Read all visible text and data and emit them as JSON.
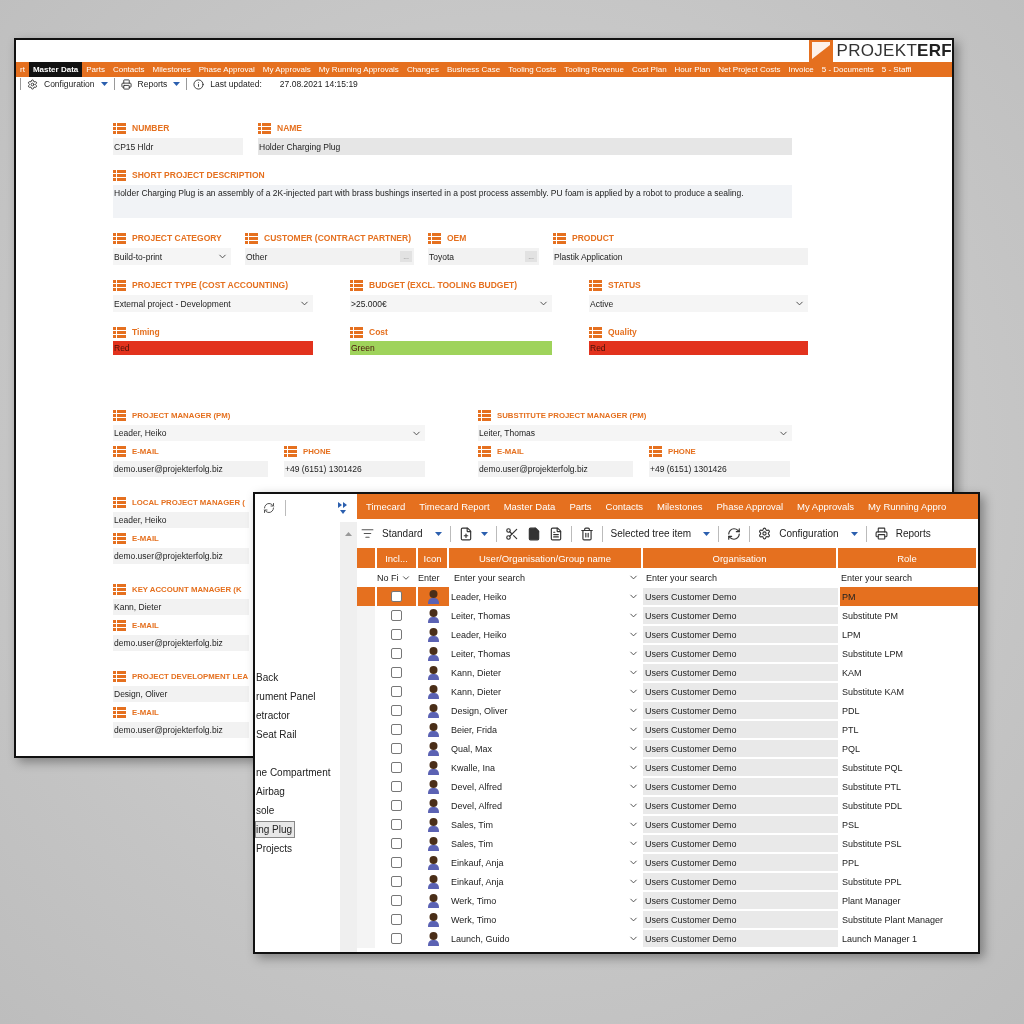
{
  "back_window": {
    "logo": "PROJEKT**ERF**",
    "tabs": [
      {
        "label": "rt",
        "selected": false
      },
      {
        "label": "Master Data",
        "selected": true
      },
      {
        "label": "Parts",
        "selected": false
      },
      {
        "label": "Contacts",
        "selected": false
      },
      {
        "label": "Milestones",
        "selected": false
      },
      {
        "label": "Phase Approval",
        "selected": false
      },
      {
        "label": "My Approvals",
        "selected": false
      },
      {
        "label": "My Running Approvals",
        "selected": false
      },
      {
        "label": "Changes",
        "selected": false
      },
      {
        "label": "Business Case",
        "selected": false
      },
      {
        "label": "Tooling Costs",
        "selected": false
      },
      {
        "label": "Tooling Revenue",
        "selected": false
      },
      {
        "label": "Cost Plan",
        "selected": false
      },
      {
        "label": "Hour Plan",
        "selected": false
      },
      {
        "label": "Net Project Costs",
        "selected": false
      },
      {
        "label": "Invoice",
        "selected": false
      },
      {
        "label": "5 - Documents",
        "selected": false
      },
      {
        "label": "5 - Staffi",
        "selected": false
      }
    ],
    "toolbar": {
      "configuration": "Configuration",
      "reports": "Reports",
      "last_updated_label": "Last updated:",
      "last_updated": "27.08.2021 14:15:19"
    },
    "form_rows": [
      [
        {
          "label": "NUMBER",
          "value": "CP15 Hldr",
          "kind": "text"
        },
        {
          "label": "NAME",
          "value": "Holder Charging Plug",
          "kind": "readonly"
        }
      ],
      [
        {
          "label": "SHORT PROJECT DESCRIPTION",
          "value": "Holder Charging Plug is an assembly of a 2K-injected part with brass bushings inserted in a post process assembly. PU foam is applied by a robot to produce a sealing.",
          "kind": "textarea"
        }
      ],
      [
        {
          "label": "PROJECT CATEGORY",
          "value": "Build-to-print",
          "kind": "select"
        },
        {
          "label": "CUSTOMER (CONTRACT PARTNER)",
          "value": "Other",
          "kind": "lookup",
          "button": "..."
        },
        {
          "label": "OEM",
          "value": "Toyota",
          "kind": "lookup",
          "button": "..."
        },
        {
          "label": "PRODUCT",
          "value": "Plastik Application",
          "kind": "text"
        }
      ],
      [
        {
          "label": "PROJECT TYPE (COST ACCOUNTING)",
          "value": "External project - Development",
          "kind": "select"
        },
        {
          "label": "BUDGET (EXCL. TOOLING BUDGET)",
          "value": ">25.000€",
          "kind": "select"
        },
        {
          "label": "STATUS",
          "value": "Active",
          "kind": "select"
        }
      ],
      [
        {
          "label": "Timing",
          "value": "Red",
          "kind": "status",
          "color": "#e2321d"
        },
        {
          "label": "Cost",
          "value": "Green",
          "kind": "status",
          "color": "#9fd35b"
        },
        {
          "label": "Quality",
          "value": "Red",
          "kind": "status",
          "color": "#e2321d"
        }
      ]
    ],
    "manager_columns": [
      [
        {
          "label": "PROJECT MANAGER (PM)",
          "value": "Leader, Heiko",
          "kind": "select",
          "contacts": [
            {
              "label": "E-MAIL",
              "value": "demo.user@projekterfolg.biz"
            },
            {
              "label": "PHONE",
              "value": "+49 (6151) 1301426"
            }
          ]
        },
        {
          "label": "LOCAL PROJECT MANAGER (",
          "value": "Leader, Heiko",
          "kind": "text",
          "contacts": [
            {
              "label": "E-MAIL",
              "value": "demo.user@projekterfolg.biz"
            }
          ]
        },
        {
          "label": "KEY ACCOUNT MANAGER (K",
          "value": "Kann, Dieter",
          "kind": "text",
          "contacts": [
            {
              "label": "E-MAIL",
              "value": "demo.user@projekterfolg.biz"
            }
          ]
        },
        {
          "label": "PROJECT DEVELOPMENT LEA",
          "value": "Design, Oliver",
          "kind": "text",
          "contacts": [
            {
              "label": "E-MAIL",
              "value": "demo.user@projekterfolg.biz"
            }
          ]
        }
      ],
      [
        {
          "label": "SUBSTITUTE PROJECT MANAGER (PM)",
          "value": "Leiter, Thomas",
          "kind": "select",
          "contacts": [
            {
              "label": "E-MAIL",
              "value": "demo.user@projekterfolg.biz"
            },
            {
              "label": "PHONE",
              "value": "+49 (6151) 1301426"
            }
          ]
        }
      ]
    ]
  },
  "front_window": {
    "tree_items": [
      {
        "label": "Back",
        "selected": false
      },
      {
        "label": "rument Panel",
        "selected": false
      },
      {
        "label": "etractor",
        "selected": false
      },
      {
        "label": "Seat Rail",
        "selected": false
      },
      {
        "label": "ne Compartment",
        "selected": false
      },
      {
        "label": "Airbag",
        "selected": false
      },
      {
        "label": "sole",
        "selected": false
      },
      {
        "label": "ing Plug",
        "selected": true
      },
      {
        "label": "Projects",
        "selected": false
      }
    ],
    "tabs": [
      {
        "label": "Timecard",
        "selected": false
      },
      {
        "label": "Timecard Report",
        "selected": false
      },
      {
        "label": "Master Data",
        "selected": false
      },
      {
        "label": "Parts",
        "selected": false
      },
      {
        "label": "Contacts",
        "selected": false
      },
      {
        "label": "Milestones",
        "selected": false
      },
      {
        "label": "Phase Approval",
        "selected": false
      },
      {
        "label": "My Approvals",
        "selected": false
      },
      {
        "label": "My Running Appro",
        "selected": false
      }
    ],
    "toolbar": {
      "view": "Standard",
      "scope": "Selected tree item",
      "configuration": "Configuration",
      "reports": "Reports"
    },
    "columns": [
      "Incl...",
      "Icon",
      "User/Organisation/Group name",
      "Organisation",
      "Role"
    ],
    "filters": {
      "include": "No Fi",
      "icon": "Enter",
      "name_placeholder": "Enter your search",
      "organisation_placeholder": "Enter your search",
      "role_placeholder": "Enter your search"
    },
    "rows": [
      {
        "name": "Leader, Heiko",
        "organisation": "Users Customer Demo",
        "role": "PM",
        "selected": true,
        "checked": false
      },
      {
        "name": "Leiter, Thomas",
        "organisation": "Users Customer Demo",
        "role": "Substitute PM",
        "selected": false,
        "checked": false
      },
      {
        "name": "Leader, Heiko",
        "organisation": "Users Customer Demo",
        "role": "LPM",
        "selected": false,
        "checked": false
      },
      {
        "name": "Leiter, Thomas",
        "organisation": "Users Customer Demo",
        "role": "Substitute LPM",
        "selected": false,
        "checked": false
      },
      {
        "name": "Kann, Dieter",
        "organisation": "Users Customer Demo",
        "role": "KAM",
        "selected": false,
        "checked": false
      },
      {
        "name": "Kann, Dieter",
        "organisation": "Users Customer Demo",
        "role": "Substitute KAM",
        "selected": false,
        "checked": false
      },
      {
        "name": "Design, Oliver",
        "organisation": "Users Customer Demo",
        "role": "PDL",
        "selected": false,
        "checked": false
      },
      {
        "name": "Beier, Frida",
        "organisation": "Users Customer Demo",
        "role": "PTL",
        "selected": false,
        "checked": false
      },
      {
        "name": "Qual, Max",
        "organisation": "Users Customer Demo",
        "role": "PQL",
        "selected": false,
        "checked": false
      },
      {
        "name": "Kwalle, Ina",
        "organisation": "Users Customer Demo",
        "role": "Substitute PQL",
        "selected": false,
        "checked": false
      },
      {
        "name": "Devel, Alfred",
        "organisation": "Users Customer Demo",
        "role": "Substitute PTL",
        "selected": false,
        "checked": false
      },
      {
        "name": "Devel, Alfred",
        "organisation": "Users Customer Demo",
        "role": "Substitute PDL",
        "selected": false,
        "checked": false
      },
      {
        "name": "Sales, Tim",
        "organisation": "Users Customer Demo",
        "role": "PSL",
        "selected": false,
        "checked": false
      },
      {
        "name": "Sales, Tim",
        "organisation": "Users Customer Demo",
        "role": "Substitute PSL",
        "selected": false,
        "checked": false
      },
      {
        "name": "Einkauf, Anja",
        "organisation": "Users Customer Demo",
        "role": "PPL",
        "selected": false,
        "checked": false
      },
      {
        "name": "Einkauf, Anja",
        "organisation": "Users Customer Demo",
        "role": "Substitute PPL",
        "selected": false,
        "checked": false
      },
      {
        "name": "Werk, Timo",
        "organisation": "Users Customer Demo",
        "role": "Plant Manager",
        "selected": false,
        "checked": false
      },
      {
        "name": "Werk, Timo",
        "organisation": "Users Customer Demo",
        "role": "Substitute Plant Manager",
        "selected": false,
        "checked": false
      },
      {
        "name": "Launch, Guido",
        "organisation": "Users Customer Demo",
        "role": "Launch Manager 1",
        "selected": false,
        "checked": false
      }
    ]
  }
}
